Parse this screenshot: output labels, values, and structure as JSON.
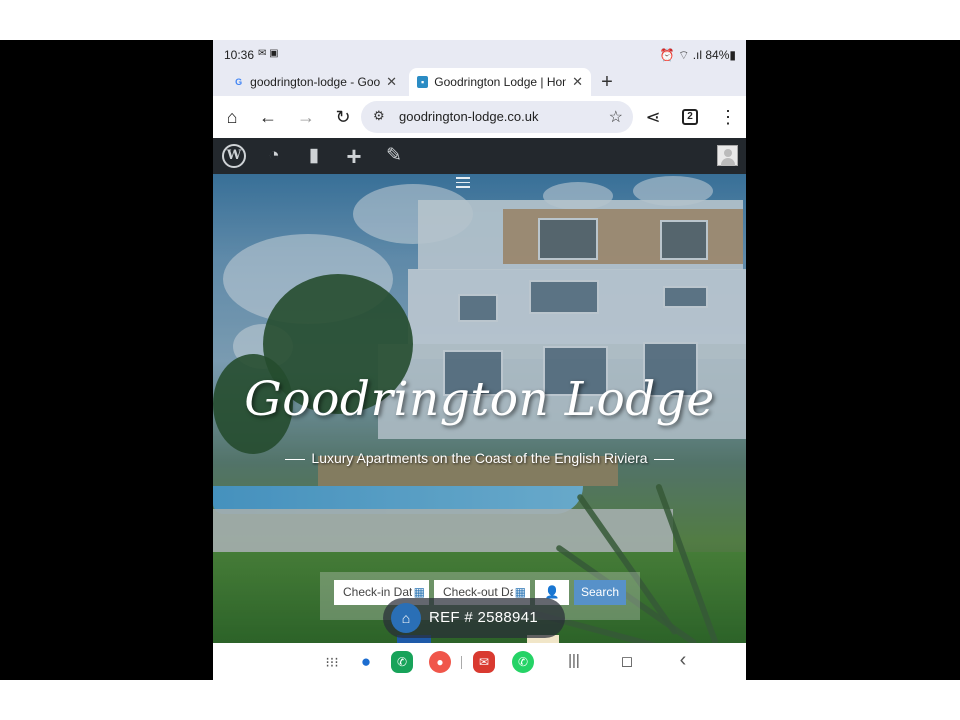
{
  "status_bar": {
    "time": "10:36",
    "left_icons": "✉ ▣",
    "right_text": "⏰ ⌔ .ıl 84%▮"
  },
  "tabs": [
    {
      "title": "goodrington-lodge - Google",
      "favicon": "G",
      "active": false
    },
    {
      "title": "Goodrington Lodge | Home",
      "favicon": "▪",
      "active": true
    }
  ],
  "toolbar": {
    "home_icon": "⌂",
    "back_icon": "←",
    "forward_icon": "→",
    "reload_icon": "↻",
    "url": "goodrington-lodge.co.uk",
    "site_settings_icon": "⚙",
    "bookmark_icon": "☆",
    "share_icon": "⋖",
    "tab_count": "2",
    "menu_icon": "⋮"
  },
  "wp_admin_bar": {
    "logo": "W",
    "dashboard_icon": "◔",
    "comments_icon": "▮",
    "new_icon": "+",
    "edit_icon": "✎"
  },
  "site": {
    "title": "Goodrington Lodge",
    "tagline": "Luxury Apartments on the Coast of the English Riviera"
  },
  "booking": {
    "checkin_placeholder": "Check-in Date",
    "checkout_placeholder": "Check-out Date",
    "calendar_icon": "▦",
    "guests_icon": "👤",
    "search_label": "Search"
  },
  "nav_bar": {
    "apps_icon": "⁝⁝⁝",
    "messages_icon": "●",
    "phone_icon": "✆",
    "contacts_icon": "●",
    "mail_icon": "✉",
    "whatsapp_icon": "✆",
    "recents_icon": "|||",
    "home_icon": "◻",
    "back_icon": "‹"
  },
  "watermark": {
    "text": "REF # 2588941",
    "icon": "⌂"
  }
}
